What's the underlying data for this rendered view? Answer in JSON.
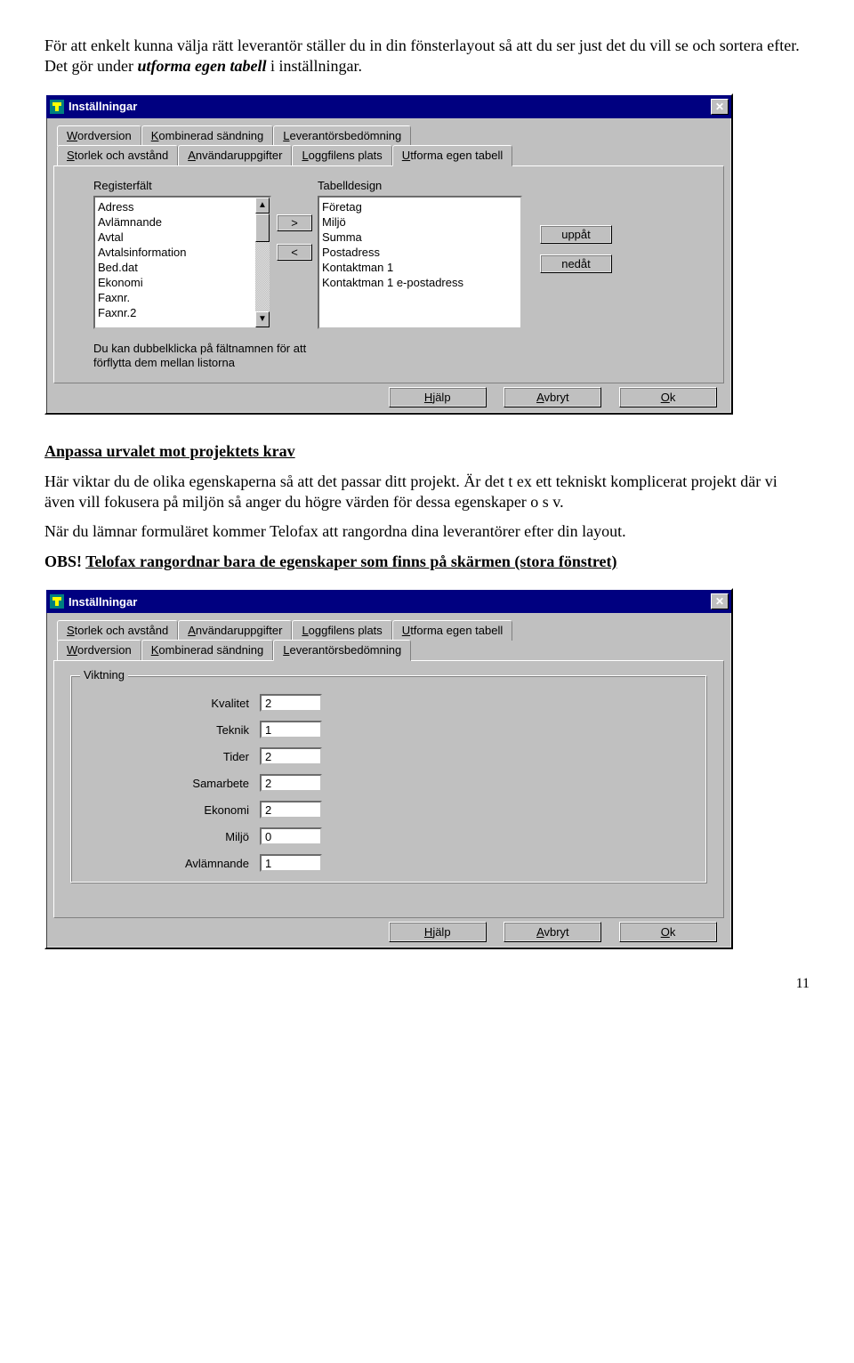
{
  "intro": {
    "p1_a": "För att enkelt kunna välja rätt leverantör ställer du in din fönsterlayout så att du ser just det du vill se och sortera efter. Det gör under ",
    "p1_em": "utforma egen tabell",
    "p1_b": " i inställningar."
  },
  "dialog1": {
    "title": "Inställningar",
    "tabs_upper": [
      "Wordversion",
      "Kombinerad sändning",
      "Leverantörsbedömning"
    ],
    "tabs_lower": [
      "Storlek och avstånd",
      "Användaruppgifter",
      "Loggfilens plats",
      "Utforma egen tabell"
    ],
    "selected_tab": 3,
    "left_label": "Registerfält",
    "right_label": "Tabelldesign",
    "left_items": [
      "Adress",
      "Avlämnande",
      "Avtal",
      "Avtalsinformation",
      "Bed.dat",
      "Ekonomi",
      "Faxnr.",
      "Faxnr.2"
    ],
    "right_items": [
      "Företag",
      "Miljö",
      "Summa",
      "Postadress",
      "Kontaktman 1",
      "Kontaktman 1 e-postadress"
    ],
    "move_right": ">",
    "move_left": "<",
    "btn_up": "uppåt",
    "btn_down": "nedåt",
    "hint": "Du kan dubbelklicka på fältnamnen för att förflytta dem mellan listorna",
    "btn_help": "Hjälp",
    "btn_cancel": "Avbryt",
    "btn_ok": "Ok"
  },
  "section": {
    "heading": "Anpassa urvalet mot projektets krav",
    "p1": "Här viktar du de olika egenskaperna så att det passar ditt projekt. Är det t ex ett tekniskt komplicerat projekt där vi även vill fokusera på miljön så anger du högre värden för dessa egenskaper o s v.",
    "p2": "När du lämnar formuläret kommer Telofax att rangordna dina leverantörer efter din layout.",
    "obs_prefix": "OBS! ",
    "obs_rest": "Telofax rangordnar bara de egenskaper som finns på skärmen  (stora fönstret)"
  },
  "dialog2": {
    "title": "Inställningar",
    "tabs_upper": [
      "Storlek och avstånd",
      "Användaruppgifter",
      "Loggfilens plats",
      "Utforma egen tabell"
    ],
    "tabs_lower": [
      "Wordversion",
      "Kombinerad sändning",
      "Leverantörsbedömning"
    ],
    "selected_tab": 2,
    "group_title": "Viktning",
    "fields": [
      {
        "label": "Kvalitet",
        "value": "2"
      },
      {
        "label": "Teknik",
        "value": "1"
      },
      {
        "label": "Tider",
        "value": "2"
      },
      {
        "label": "Samarbete",
        "value": "2"
      },
      {
        "label": "Ekonomi",
        "value": "2"
      },
      {
        "label": "Miljö",
        "value": "0"
      },
      {
        "label": "Avlämnande",
        "value": "1"
      }
    ],
    "btn_help": "Hjälp",
    "btn_cancel": "Avbryt",
    "btn_ok": "Ok"
  },
  "page_number": "11"
}
